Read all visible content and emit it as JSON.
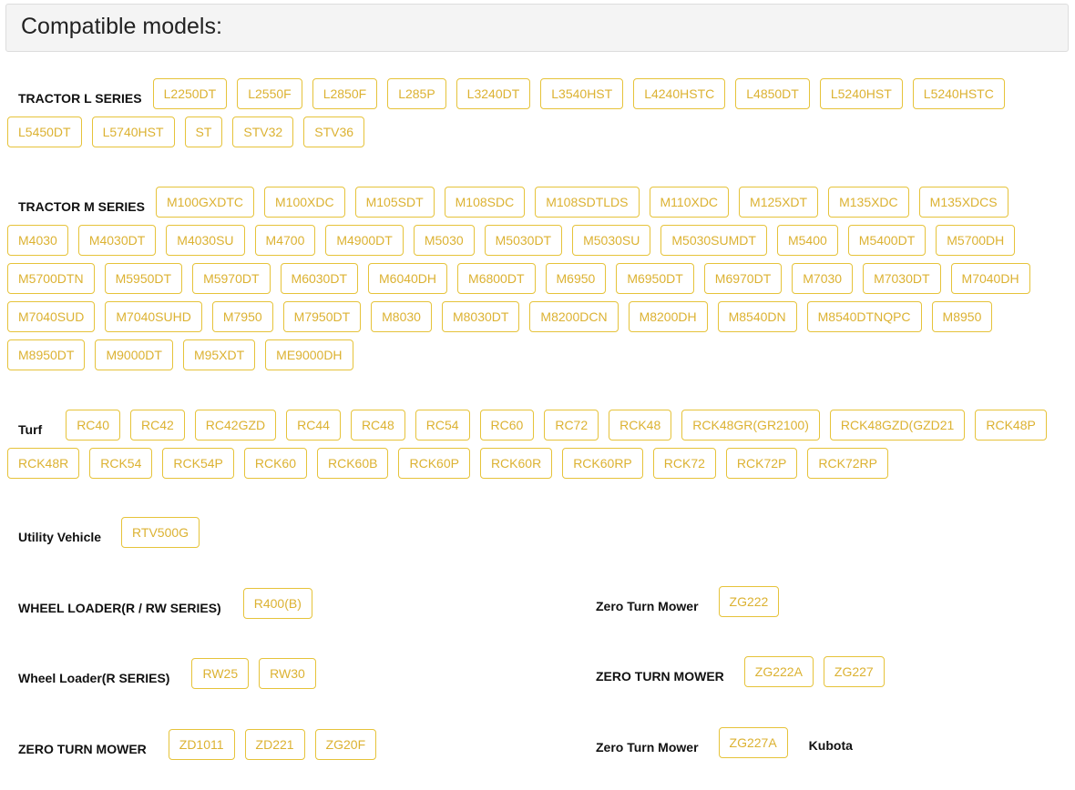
{
  "header": {
    "title": "Compatible models:"
  },
  "sections": {
    "tractor_l": {
      "label": "TRACTOR L SERIES",
      "models": [
        "L2250DT",
        "L2550F",
        "L2850F",
        "L285P",
        "L3240DT",
        "L3540HST",
        "L4240HSTC",
        "L4850DT",
        "L5240HST",
        "L5240HSTC",
        "L5450DT",
        "L5740HST",
        "ST",
        "STV32",
        "STV36"
      ]
    },
    "tractor_m": {
      "label": "TRACTOR M SERIES",
      "models": [
        "M100GXDTC",
        "M100XDC",
        "M105SDT",
        "M108SDC",
        "M108SDTLDS",
        "M110XDC",
        "M125XDT",
        "M135XDC",
        "M135XDCS",
        "M4030",
        "M4030DT",
        "M4030SU",
        "M4700",
        "M4900DT",
        "M5030",
        "M5030DT",
        "M5030SU",
        "M5030SUMDT",
        "M5400",
        "M5400DT",
        "M5700DH",
        "M5700DTN",
        "M5950DT",
        "M5970DT",
        "M6030DT",
        "M6040DH",
        "M6800DT",
        "M6950",
        "M6950DT",
        "M6970DT",
        "M7030",
        "M7030DT",
        "M7040DH",
        "M7040SUD",
        "M7040SUHD",
        "M7950",
        "M7950DT",
        "M8030",
        "M8030DT",
        "M8200DCN",
        "M8200DH",
        "M8540DN",
        "M8540DTNQPC",
        "M8950",
        "M8950DT",
        "M9000DT",
        "M95XDT",
        "ME9000DH"
      ]
    },
    "turf": {
      "label": "Turf",
      "models": [
        "RC40",
        "RC42",
        "RC42GZD",
        "RC44",
        "RC48",
        "RC54",
        "RC60",
        "RC72",
        "RCK48",
        "RCK48GR(GR2100)",
        "RCK48GZD(GZD21",
        "RCK48P",
        "RCK48R",
        "RCK54",
        "RCK54P",
        "RCK60",
        "RCK60B",
        "RCK60P",
        "RCK60R",
        "RCK60RP",
        "RCK72",
        "RCK72P",
        "RCK72RP"
      ]
    },
    "utility_vehicle": {
      "label": "Utility Vehicle",
      "models": [
        "RTV500G"
      ]
    },
    "wheel_loader_r_rw": {
      "label": "WHEEL LOADER(R / RW SERIES)",
      "models": [
        "R400(B)"
      ]
    },
    "zero_turn_mower_1": {
      "label": "Zero Turn Mower",
      "models": [
        "ZG222"
      ]
    },
    "wheel_loader_r": {
      "label": "Wheel Loader(R SERIES)",
      "models": [
        "RW25",
        "RW30"
      ]
    },
    "zero_turn_mower_caps_1": {
      "label": "ZERO TURN MOWER",
      "models": [
        "ZG222A",
        "ZG227"
      ]
    },
    "zero_turn_mower_caps_2": {
      "label": "ZERO TURN MOWER",
      "models": [
        "ZD1011",
        "ZD221",
        "ZG20F"
      ]
    },
    "zero_turn_mower_2": {
      "label": "Zero Turn Mower",
      "models": [
        "ZG227A"
      ],
      "brand": "Kubota"
    }
  }
}
